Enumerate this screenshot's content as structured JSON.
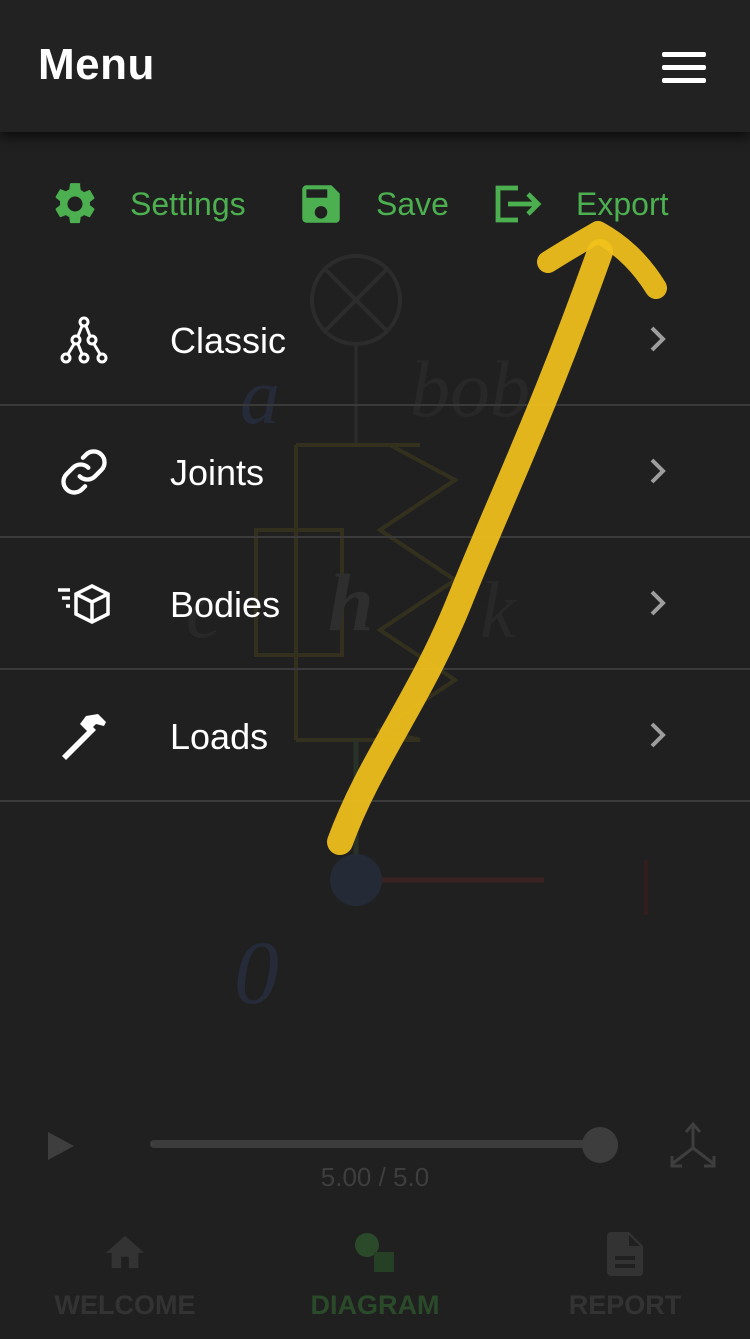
{
  "header": {
    "title": "Menu"
  },
  "actions": [
    {
      "label": "Settings",
      "icon": "gear-icon"
    },
    {
      "label": "Save",
      "icon": "floppy-disk-icon"
    },
    {
      "label": "Export",
      "icon": "export-icon"
    }
  ],
  "menu": [
    {
      "label": "Classic",
      "icon": "tree-graph-icon"
    },
    {
      "label": "Joints",
      "icon": "link-icon"
    },
    {
      "label": "Bodies",
      "icon": "moving-cube-icon"
    },
    {
      "label": "Loads",
      "icon": "hammer-icon"
    }
  ],
  "diagram": {
    "labels": [
      "a",
      "bob",
      "c",
      "h",
      "k",
      "0"
    ]
  },
  "player": {
    "time": "5.00 / 5.0",
    "progress": 1.0
  },
  "nav": [
    {
      "label": "WELCOME",
      "icon": "home-icon"
    },
    {
      "label": "DIAGRAM",
      "icon": "shapes-icon"
    },
    {
      "label": "REPORT",
      "icon": "document-icon"
    }
  ],
  "colors": {
    "accent": "#4caf50",
    "background": "#202020",
    "header": "#222222",
    "annotation": "#f2c21b"
  }
}
